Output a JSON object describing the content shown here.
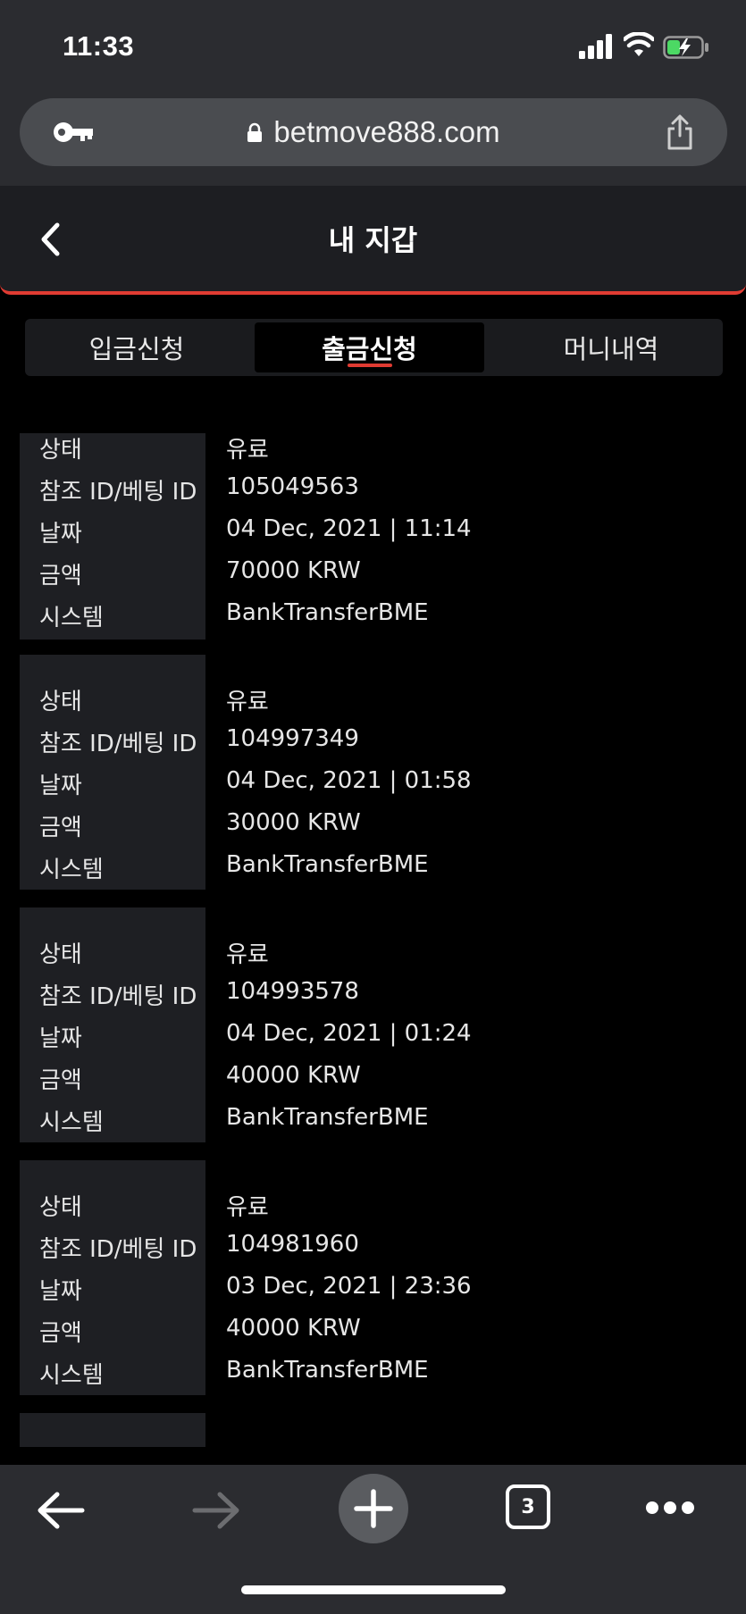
{
  "status_bar": {
    "time": "11:33"
  },
  "browser": {
    "url": "betmove888.com",
    "tab_count": "3"
  },
  "header": {
    "title": "내 지갑"
  },
  "tabs": [
    {
      "label": "입금신청",
      "active": false
    },
    {
      "label": "출금신청",
      "active": true
    },
    {
      "label": "머니내역",
      "active": false
    }
  ],
  "labels": {
    "status": "상태",
    "ref_id": "참조 ID/베팅 ID",
    "date": "날짜",
    "amount": "금액",
    "system": "시스템"
  },
  "records": [
    {
      "status": "유료",
      "ref_id": "105049563",
      "date": "04 Dec, 2021 | 11:14",
      "amount": "70000 KRW",
      "system": "BankTransferBME"
    },
    {
      "status": "유료",
      "ref_id": "104997349",
      "date": "04 Dec, 2021 | 01:58",
      "amount": "30000 KRW",
      "system": "BankTransferBME"
    },
    {
      "status": "유료",
      "ref_id": "104993578",
      "date": "04 Dec, 2021 | 01:24",
      "amount": "40000 KRW",
      "system": "BankTransferBME"
    },
    {
      "status": "유료",
      "ref_id": "104981960",
      "date": "03 Dec, 2021 | 23:36",
      "amount": "40000 KRW",
      "system": "BankTransferBME"
    }
  ],
  "colors": {
    "accent": "#e03b32",
    "chrome": "#2b2c30",
    "card": "#1e1f23"
  }
}
